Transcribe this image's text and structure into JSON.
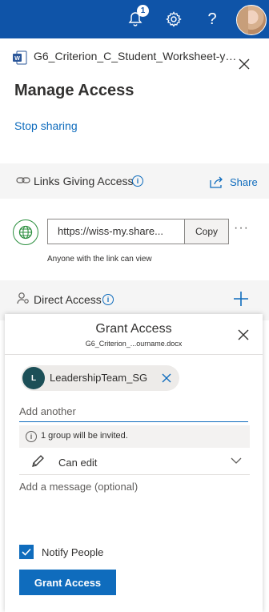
{
  "header": {
    "notification_count": "1",
    "bell_icon": "bell-icon",
    "settings_icon": "gear-icon",
    "help_label": "?",
    "avatar_icon": "user-avatar",
    "background_color": "#0f54a8"
  },
  "panel": {
    "document_name": "G6_Criterion_C_Student_Worksheet-you...",
    "document_icon": "word-doc-icon",
    "close_icon": "close-icon",
    "title": "Manage Access",
    "stop_sharing_label": "Stop sharing"
  },
  "links_section": {
    "label": "Links Giving Access",
    "info_glyph": "i",
    "share_label": "Share",
    "link": {
      "url": "https://wiss-my.share...",
      "copy_label": "Copy",
      "more_label": "···",
      "caption": "Anyone with the link can view"
    }
  },
  "direct_section": {
    "label": "Direct Access",
    "info_glyph": "i",
    "add_icon": "plus-icon"
  },
  "grant_access": {
    "title": "Grant Access",
    "subtitle": "G6_Criterion_...ourname.docx",
    "recipient": {
      "initial": "L",
      "name": "LeadershipTeam_SG"
    },
    "add_placeholder": "Add another",
    "info_text": "1 group will be invited.",
    "info_glyph": "i",
    "permission": "Can edit",
    "message_placeholder": "Add a message (optional)",
    "notify_label": "Notify People",
    "notify_checked": true,
    "button_label": "Grant Access",
    "accent_color": "#0f6cbd"
  }
}
